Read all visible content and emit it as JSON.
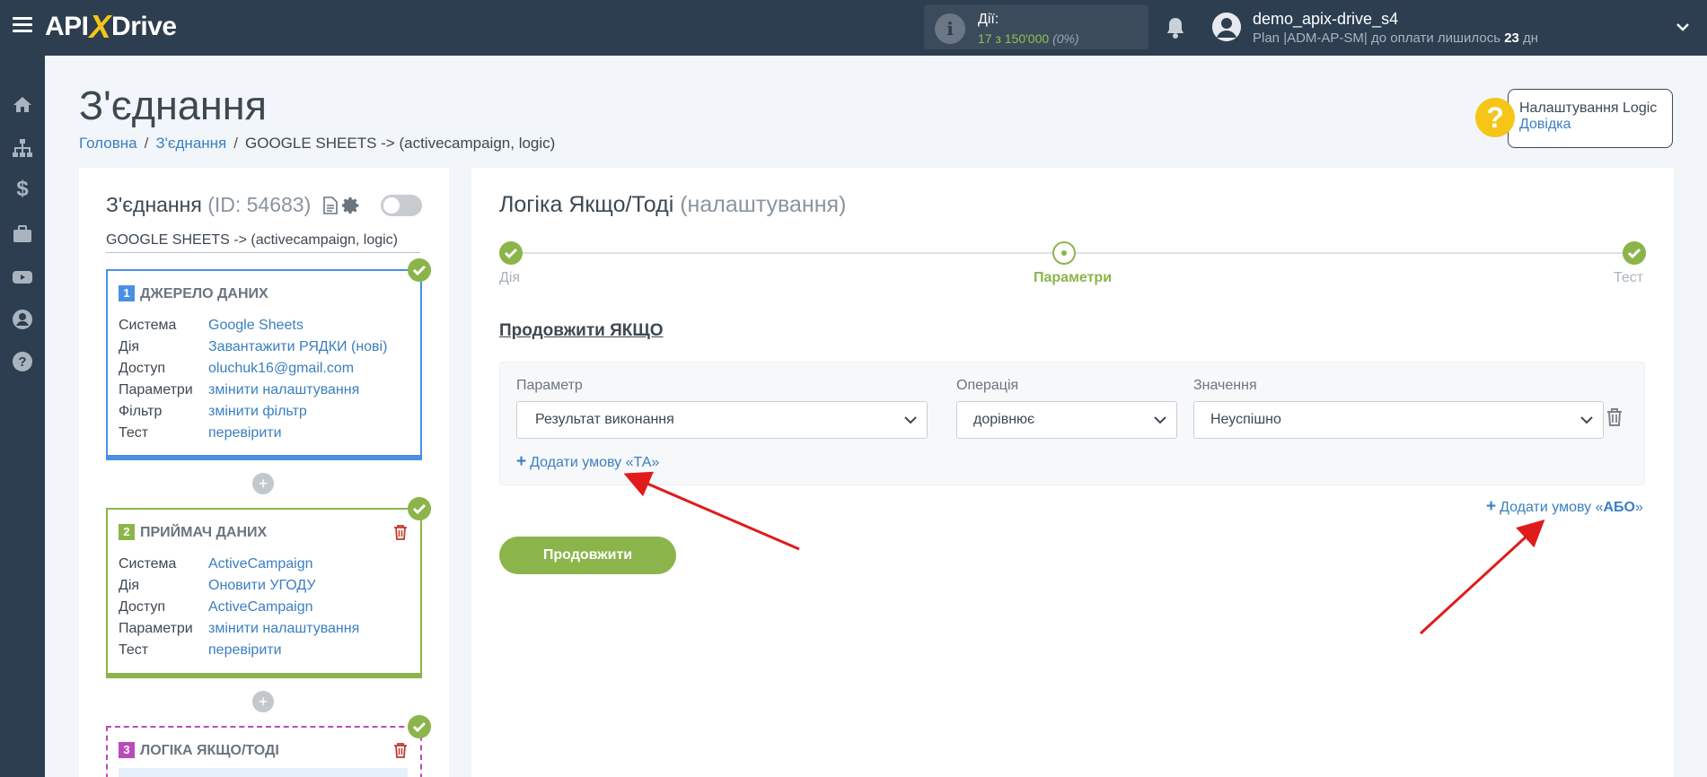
{
  "app": {
    "logo_left": "API",
    "logo_x": "X",
    "logo_right": "Drive"
  },
  "topbar": {
    "actions_label": "Дії:",
    "actions_count": "17 з 150'000",
    "actions_percent": "(0%)",
    "username": "demo_apix-drive_s4",
    "plan_text": "Plan |ADM-AP-SM| до оплати лишилось ",
    "plan_days": "23",
    "plan_suffix": " дн"
  },
  "sidebar": {
    "icons": [
      "home-icon",
      "sitemap-icon",
      "dollar-icon",
      "briefcase-icon",
      "youtube-icon",
      "user-circle-icon",
      "question-icon"
    ]
  },
  "page": {
    "title": "З'єднання",
    "breadcrumb": [
      "Головна",
      "З'єднання",
      "GOOGLE SHEETS -> (activecampaign, logic)"
    ]
  },
  "help": {
    "title": "Налаштування Logic",
    "link": "Довідка"
  },
  "connection": {
    "title": "З'єднання",
    "id_text": "(ID: 54683)",
    "name": "GOOGLE SHEETS -> (activecampaign, logic)",
    "blocks": [
      {
        "number": "1",
        "title": "ДЖЕРЕЛО ДАНИХ",
        "rows": [
          {
            "k": "Система",
            "v": "Google Sheets"
          },
          {
            "k": "Дія",
            "v": "Завантажити РЯДКИ (нові)"
          },
          {
            "k": "Доступ",
            "v": "oluchuk16@gmail.com"
          },
          {
            "k": "Параметри",
            "v": "змінити налаштування"
          },
          {
            "k": "Фільтр",
            "v": "змінити фільтр"
          },
          {
            "k": "Тест",
            "v": "перевірити"
          }
        ]
      },
      {
        "number": "2",
        "title": "ПРИЙМАЧ ДАНИХ",
        "rows": [
          {
            "k": "Система",
            "v": "ActiveCampaign"
          },
          {
            "k": "Дія",
            "v": "Оновити УГОДУ"
          },
          {
            "k": "Доступ",
            "v": "ActiveCampaign"
          },
          {
            "k": "Параметри",
            "v": "змінити налаштування"
          },
          {
            "k": "Тест",
            "v": "перевірити"
          }
        ]
      },
      {
        "number": "3",
        "title": "ЛОГІКА ЯКЩО/ТОДІ"
      }
    ]
  },
  "logic": {
    "title": "Логіка Якщо/Тоді",
    "subtitle": "(налаштування)",
    "steps": [
      "Дія",
      "Параметри",
      "Тест"
    ],
    "continue_if": "Продовжити ЯКЩО",
    "labels": {
      "param": "Параметр",
      "op": "Операція",
      "value": "Значення"
    },
    "condition": {
      "param": "Результат виконання",
      "op": "дорівнює",
      "value": "Неуспішно"
    },
    "add_and": "Додати умову «ТА»",
    "add_or_prefix": "Додати умову «",
    "add_or_bold": "АБО",
    "add_or_suffix": "»",
    "continue_button": "Продовжити"
  },
  "colors": {
    "topbar": "#2c3e50",
    "accent_green": "#8bb54a",
    "link_blue": "#3a7fc0",
    "source_blue": "#4a90e2",
    "logic_purple": "#b94bbd",
    "help_yellow": "#f5c518",
    "trash_red": "#c0392b",
    "annotation_red": "#e01b1b"
  }
}
